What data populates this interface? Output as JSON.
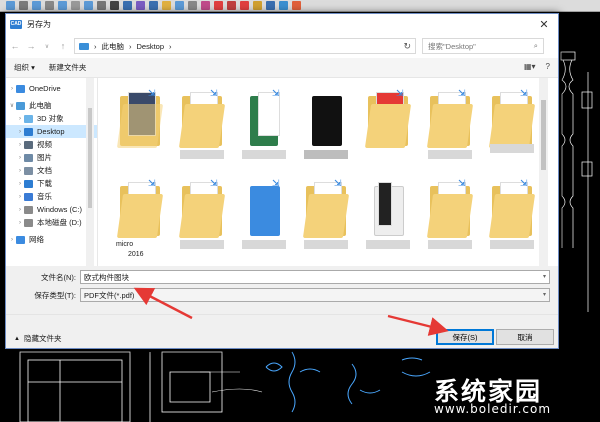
{
  "dialog": {
    "title": "另存为",
    "app_icon_text": "CAD",
    "close_glyph": "✕"
  },
  "address": {
    "path": [
      "此电脑",
      "Desktop"
    ],
    "separator": "›",
    "search_placeholder": "搜索\"Desktop\""
  },
  "toolbar": {
    "organize": "组织 ▾",
    "new_folder": "新建文件夹"
  },
  "nav_tree": [
    {
      "label": "OneDrive",
      "icon": "cloud-icon",
      "color": "#3b8be0",
      "arrow": "›",
      "selected": false
    },
    {
      "label": "此电脑",
      "icon": "computer-icon",
      "color": "#4a9ad8",
      "arrow": "∨",
      "selected": false
    },
    {
      "label": "3D 对象",
      "icon": "cube-icon",
      "color": "#6bb4e8",
      "arrow": "›",
      "selected": false
    },
    {
      "label": "Desktop",
      "icon": "desktop-icon",
      "color": "#2d7dd2",
      "arrow": "›",
      "selected": true
    },
    {
      "label": "视频",
      "icon": "video-icon",
      "color": "#5a6b7d",
      "arrow": "›",
      "selected": false
    },
    {
      "label": "图片",
      "icon": "picture-icon",
      "color": "#6e8aa6",
      "arrow": "›",
      "selected": false
    },
    {
      "label": "文档",
      "icon": "document-icon",
      "color": "#7c8fa3",
      "arrow": "›",
      "selected": false
    },
    {
      "label": "下载",
      "icon": "download-icon",
      "color": "#2d7dd2",
      "arrow": "›",
      "selected": false
    },
    {
      "label": "音乐",
      "icon": "music-icon",
      "color": "#3a7bd5",
      "arrow": "›",
      "selected": false
    },
    {
      "label": "Windows (C:)",
      "icon": "drive-icon",
      "color": "#8a8a8a",
      "arrow": "›",
      "selected": false
    },
    {
      "label": "本地磁盘 (D:)",
      "icon": "drive-icon",
      "color": "#8a8a8a",
      "arrow": "›",
      "selected": false
    },
    {
      "label": "网络",
      "icon": "network-icon",
      "color": "#3b8be0",
      "arrow": "›",
      "selected": false
    }
  ],
  "files": {
    "labels": [
      "micro",
      "2016"
    ]
  },
  "form": {
    "filename_label": "文件名(N):",
    "filename_value": "欧式构件图块",
    "filetype_label": "保存类型(T):",
    "filetype_value": "PDF文件(*.pdf)"
  },
  "footer": {
    "hide_folders": "隐藏文件夹",
    "save": "保存(S)",
    "cancel": "取消"
  },
  "watermark": {
    "title": "系统家园",
    "url": "www.boledir.com"
  },
  "colors": {
    "accent": "#0078d7",
    "arrow": "#e53935",
    "folder": "#f4d27a",
    "selected_bg": "#cce8ff"
  }
}
